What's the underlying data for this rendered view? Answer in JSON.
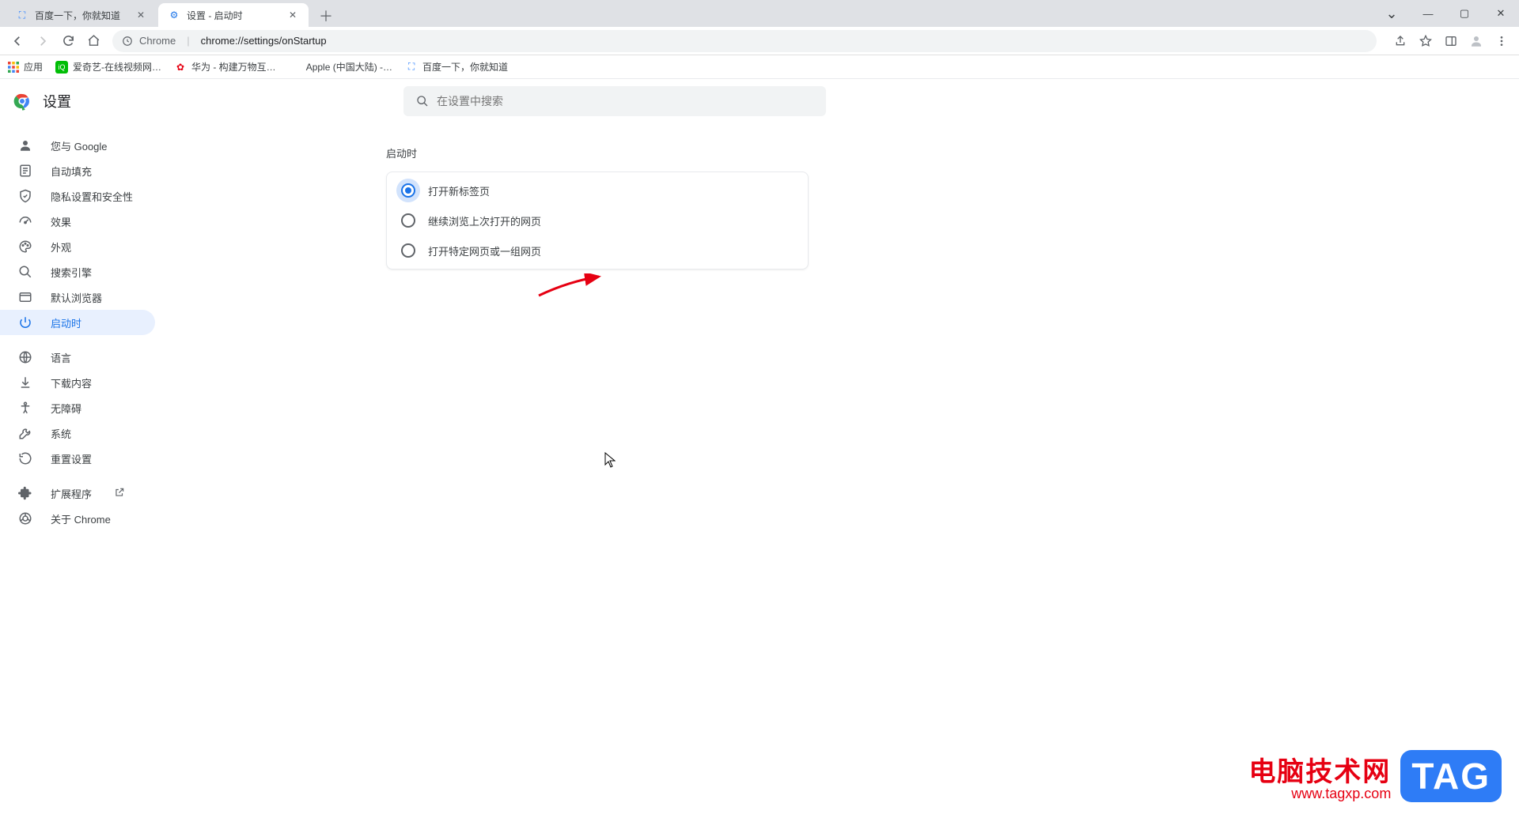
{
  "tabs": [
    {
      "title": "百度一下，你就知道",
      "favicon": "baidu",
      "active": false
    },
    {
      "title": "设置 - 启动时",
      "favicon": "settings",
      "active": true
    }
  ],
  "toolbar": {
    "url_app": "Chrome",
    "url_path": "chrome://settings/onStartup"
  },
  "bookmarks": {
    "apps_label": "应用",
    "items": [
      {
        "label": "爱奇艺-在线视频网…",
        "icon": "iqiyi"
      },
      {
        "label": "华为 - 构建万物互…",
        "icon": "huawei"
      },
      {
        "label": "Apple (中国大陆) -…",
        "icon": "apple"
      },
      {
        "label": "百度一下，你就知道",
        "icon": "baidu"
      }
    ]
  },
  "settings": {
    "title": "设置",
    "search_placeholder": "在设置中搜索",
    "nav": [
      {
        "label": "您与 Google",
        "icon": "person"
      },
      {
        "label": "自动填充",
        "icon": "autofill"
      },
      {
        "label": "隐私设置和安全性",
        "icon": "shield"
      },
      {
        "label": "效果",
        "icon": "speed"
      },
      {
        "label": "外观",
        "icon": "palette"
      },
      {
        "label": "搜索引擎",
        "icon": "search"
      },
      {
        "label": "默认浏览器",
        "icon": "browser"
      },
      {
        "label": "启动时",
        "icon": "power",
        "active": true
      }
    ],
    "nav2": [
      {
        "label": "语言",
        "icon": "globe"
      },
      {
        "label": "下载内容",
        "icon": "download"
      },
      {
        "label": "无障碍",
        "icon": "accessibility"
      },
      {
        "label": "系统",
        "icon": "wrench"
      },
      {
        "label": "重置设置",
        "icon": "restore"
      }
    ],
    "nav3": [
      {
        "label": "扩展程序",
        "icon": "extension",
        "external": true
      },
      {
        "label": "关于 Chrome",
        "icon": "chrome"
      }
    ],
    "section_title": "启动时",
    "radios": [
      {
        "label": "打开新标签页",
        "selected": true
      },
      {
        "label": "继续浏览上次打开的网页",
        "selected": false
      },
      {
        "label": "打开特定网页或一组网页",
        "selected": false
      }
    ]
  },
  "watermark": {
    "line1": "电脑技术网",
    "line2": "www.tagxp.com",
    "tag": "TAG"
  }
}
